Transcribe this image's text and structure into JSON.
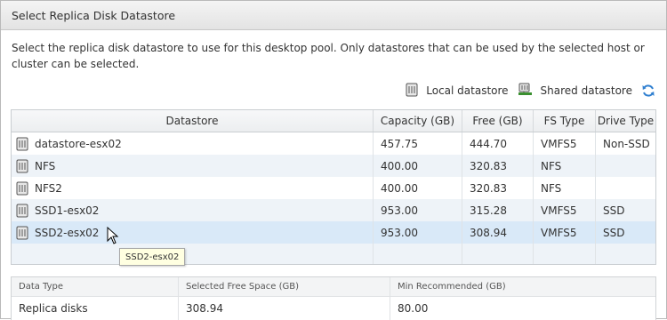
{
  "dialog": {
    "title": "Select Replica Disk Datastore",
    "description": "Select the replica disk datastore to use for this desktop pool. Only datastores that can be used by the selected host or cluster can be selected."
  },
  "legend": {
    "local_label": "Local datastore",
    "shared_label": "Shared datastore",
    "local_icon": "local-datastore-icon",
    "shared_icon": "shared-datastore-icon",
    "refresh_icon": "refresh-icon"
  },
  "grid": {
    "columns": [
      "Datastore",
      "Capacity (GB)",
      "Free (GB)",
      "FS Type",
      "Drive Type"
    ],
    "rows": [
      {
        "name": "datastore-esx02",
        "capacity": "457.75",
        "free": "444.70",
        "fs": "VMFS5",
        "drive": "Non-SSD"
      },
      {
        "name": "NFS",
        "capacity": "400.00",
        "free": "320.83",
        "fs": "NFS",
        "drive": ""
      },
      {
        "name": "NFS2",
        "capacity": "400.00",
        "free": "320.83",
        "fs": "NFS",
        "drive": ""
      },
      {
        "name": "SSD1-esx02",
        "capacity": "953.00",
        "free": "315.28",
        "fs": "VMFS5",
        "drive": "SSD"
      },
      {
        "name": "SSD2-esx02",
        "capacity": "953.00",
        "free": "308.94",
        "fs": "VMFS5",
        "drive": "SSD"
      }
    ]
  },
  "tooltip": "SSD2-esx02",
  "summary": {
    "headers": [
      "Data Type",
      "Selected Free Space (GB)",
      "Min Recommended (GB)"
    ],
    "row": [
      "Replica disks",
      "308.94",
      "80.00"
    ]
  }
}
